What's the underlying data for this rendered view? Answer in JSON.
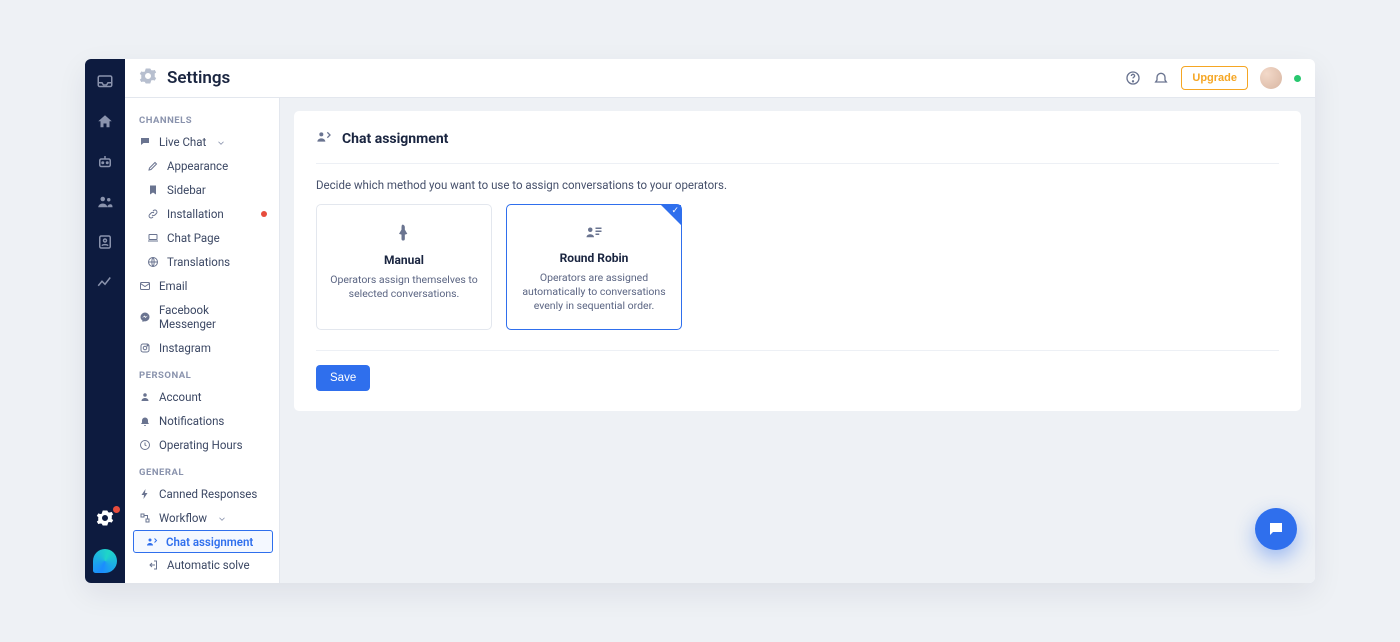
{
  "header": {
    "title": "Settings",
    "upgrade_label": "Upgrade"
  },
  "sidebar": {
    "sections": [
      {
        "title": "CHANNELS",
        "items": [
          {
            "label": "Live Chat",
            "icon": "chat",
            "expandable": true,
            "active": false
          },
          {
            "label": "Appearance",
            "icon": "pencil",
            "child": true
          },
          {
            "label": "Sidebar",
            "icon": "bookmark",
            "child": true
          },
          {
            "label": "Installation",
            "icon": "link",
            "child": true,
            "alert": true
          },
          {
            "label": "Chat Page",
            "icon": "laptop",
            "child": true
          },
          {
            "label": "Translations",
            "icon": "globe",
            "child": true
          },
          {
            "label": "Email",
            "icon": "mail"
          },
          {
            "label": "Facebook Messenger",
            "icon": "messenger"
          },
          {
            "label": "Instagram",
            "icon": "instagram"
          }
        ]
      },
      {
        "title": "PERSONAL",
        "items": [
          {
            "label": "Account",
            "icon": "user"
          },
          {
            "label": "Notifications",
            "icon": "bell"
          },
          {
            "label": "Operating Hours",
            "icon": "clock"
          }
        ]
      },
      {
        "title": "GENERAL",
        "items": [
          {
            "label": "Canned Responses",
            "icon": "bolt"
          },
          {
            "label": "Workflow",
            "icon": "flow",
            "expandable": true
          },
          {
            "label": "Chat assignment",
            "icon": "assign",
            "child": true,
            "active": true
          },
          {
            "label": "Automatic solve",
            "icon": "exit",
            "child": true
          }
        ]
      }
    ]
  },
  "panel": {
    "title": "Chat assignment",
    "description": "Decide which method you want to use to assign conversations to your operators.",
    "cards": [
      {
        "title": "Manual",
        "desc": "Operators assign themselves to selected conversations.",
        "selected": false
      },
      {
        "title": "Round Robin",
        "desc": "Operators are assigned automatically to conversations evenly in sequential order.",
        "selected": true
      }
    ],
    "save_label": "Save"
  }
}
